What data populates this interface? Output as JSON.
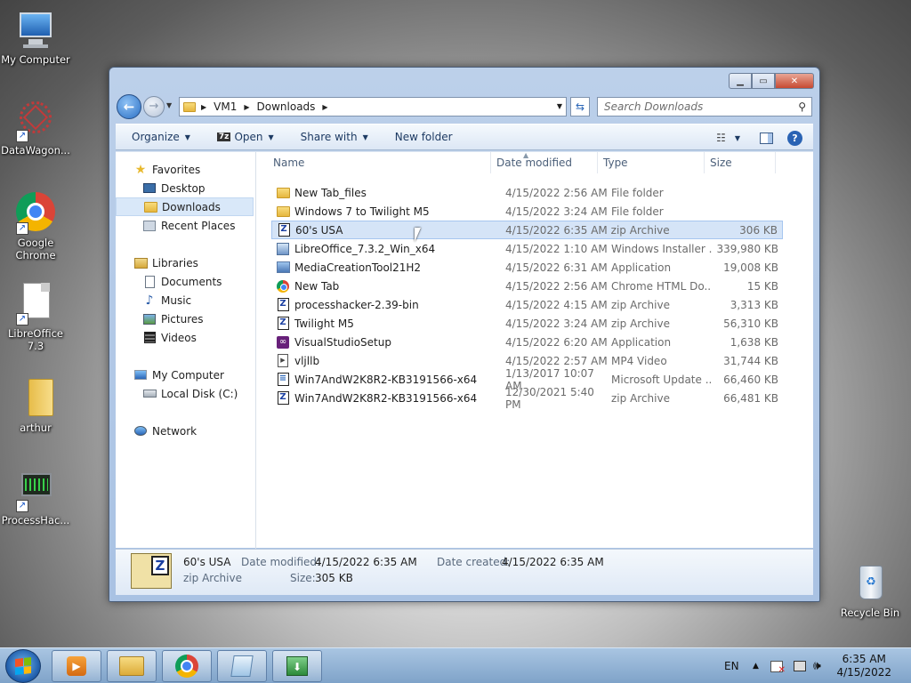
{
  "desktop": {
    "icons": [
      {
        "label": "My Computer"
      },
      {
        "label": "DataWagon..."
      },
      {
        "label": "Google Chrome"
      },
      {
        "label": "LibreOffice 7.3"
      },
      {
        "label": "arthur"
      },
      {
        "label": "ProcessHac..."
      },
      {
        "label": "Recycle Bin"
      }
    ]
  },
  "window": {
    "buttons": {
      "minimize": "▁",
      "maximize": "▭",
      "close": "✕"
    },
    "address": {
      "crumbs": [
        "VM1",
        "Downloads"
      ]
    },
    "search": {
      "placeholder": "Search Downloads"
    },
    "toolbar": {
      "organize": "Organize",
      "open": "Open",
      "open_badge": "7z",
      "share_with": "Share with",
      "new_folder": "New folder"
    },
    "navpane": {
      "favorites": "Favorites",
      "desktop": "Desktop",
      "downloads": "Downloads",
      "recent": "Recent Places",
      "libraries": "Libraries",
      "documents": "Documents",
      "music": "Music",
      "pictures": "Pictures",
      "videos": "Videos",
      "my_computer": "My Computer",
      "local_disk": "Local Disk (C:)",
      "network": "Network"
    },
    "columns": {
      "name": "Name",
      "date": "Date modified",
      "type": "Type",
      "size": "Size"
    },
    "files": [
      {
        "name": "New Tab_files",
        "date": "4/15/2022 2:56 AM",
        "type": "File folder",
        "size": "",
        "icon": "folder"
      },
      {
        "name": "Windows 7 to Twilight M5",
        "date": "4/15/2022 3:24 AM",
        "type": "File folder",
        "size": "",
        "icon": "folder"
      },
      {
        "name": "60's USA",
        "date": "4/15/2022 6:35 AM",
        "type": "zip Archive",
        "size": "306 KB",
        "icon": "zip"
      },
      {
        "name": "LibreOffice_7.3.2_Win_x64",
        "date": "4/15/2022 1:10 AM",
        "type": "Windows Installer ...",
        "size": "339,980 KB",
        "icon": "msi"
      },
      {
        "name": "MediaCreationTool21H2",
        "date": "4/15/2022 6:31 AM",
        "type": "Application",
        "size": "19,008 KB",
        "icon": "app"
      },
      {
        "name": "New Tab",
        "date": "4/15/2022 2:56 AM",
        "type": "Chrome HTML Do...",
        "size": "15 KB",
        "icon": "chrome"
      },
      {
        "name": "processhacker-2.39-bin",
        "date": "4/15/2022 4:15 AM",
        "type": "zip Archive",
        "size": "3,313 KB",
        "icon": "zip"
      },
      {
        "name": "Twilight M5",
        "date": "4/15/2022 3:24 AM",
        "type": "zip Archive",
        "size": "56,310 KB",
        "icon": "zip"
      },
      {
        "name": "VisualStudioSetup",
        "date": "4/15/2022 6:20 AM",
        "type": "Application",
        "size": "1,638 KB",
        "icon": "vs"
      },
      {
        "name": "vljllb",
        "date": "4/15/2022 2:57 AM",
        "type": "MP4 Video",
        "size": "31,744 KB",
        "icon": "mp4"
      },
      {
        "name": "Win7AndW2K8R2-KB3191566-x64",
        "date": "1/13/2017 10:07 AM",
        "type": "Microsoft Update ...",
        "size": "66,460 KB",
        "icon": "msu"
      },
      {
        "name": "Win7AndW2K8R2-KB3191566-x64",
        "date": "12/30/2021 5:40 PM",
        "type": "zip Archive",
        "size": "66,481 KB",
        "icon": "zip"
      }
    ],
    "details": {
      "name": "60's USA",
      "kind": "zip Archive",
      "modified_label": "Date modified:",
      "modified": "4/15/2022 6:35 AM",
      "created_label": "Date created:",
      "created": "4/15/2022 6:35 AM",
      "size_label": "Size:",
      "size": "305 KB"
    }
  },
  "taskbar": {
    "lang": "EN",
    "time": "6:35 AM",
    "date": "4/15/2022"
  }
}
